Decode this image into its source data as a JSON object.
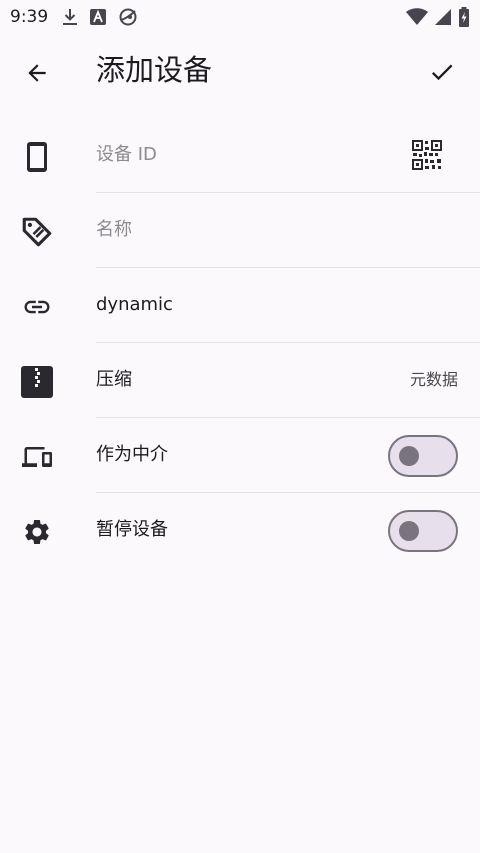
{
  "status_bar": {
    "time": "9:39",
    "icons": [
      "download-icon",
      "font-a-icon",
      "sync-globe-icon"
    ],
    "right_icons": [
      "wifi-icon",
      "signal-icon",
      "battery-charging-icon"
    ]
  },
  "app_bar": {
    "title": "添加设备",
    "back_icon": "arrow-back-icon",
    "confirm_icon": "check-icon"
  },
  "fields": {
    "device_id": {
      "placeholder": "设备 ID",
      "value": ""
    },
    "name": {
      "placeholder": "名称",
      "value": ""
    },
    "address": {
      "value": "dynamic"
    },
    "compression": {
      "label": "压缩",
      "value": "元数据"
    },
    "introducer": {
      "label": "作为中介",
      "checked": false
    },
    "paused": {
      "label": "暂停设备",
      "checked": false
    }
  },
  "colors": {
    "background": "#FCF9FC",
    "icon": "#2B2930",
    "divider": "#E5E1E6",
    "switch_outline": "#79747E",
    "switch_track": "#E7E0EC"
  }
}
